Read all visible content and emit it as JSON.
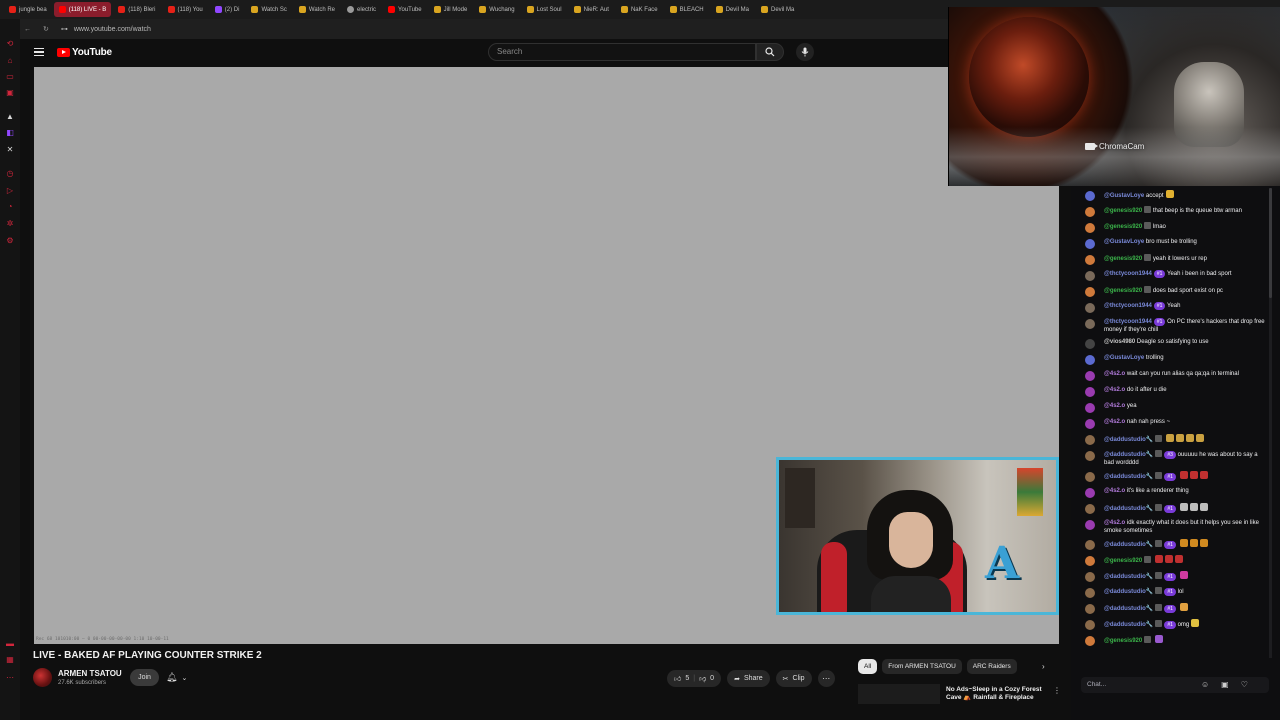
{
  "browser": {
    "tabs": [
      {
        "label": "jungle bea",
        "fav": "red",
        "active": false
      },
      {
        "label": "(118) LIVE - B",
        "fav": "yt",
        "active": true
      },
      {
        "label": "(118) Bleri",
        "fav": "red",
        "active": false
      },
      {
        "label": "(118) You",
        "fav": "red",
        "active": false
      },
      {
        "label": "(2) Di",
        "fav": "purple",
        "active": false
      },
      {
        "label": "Watch Sc",
        "fav": "amber",
        "active": false
      },
      {
        "label": "Watch Re",
        "fav": "amber",
        "active": false
      },
      {
        "label": "electric",
        "fav": "grey",
        "active": false
      },
      {
        "label": "YouTube",
        "fav": "yt",
        "active": false
      },
      {
        "label": "Jill Mode",
        "fav": "amber",
        "active": false
      },
      {
        "label": "Wuchang",
        "fav": "amber",
        "active": false
      },
      {
        "label": "Lost Soul",
        "fav": "amber",
        "active": false
      },
      {
        "label": "NieR: Aut",
        "fav": "amber",
        "active": false
      },
      {
        "label": "NaK Face",
        "fav": "amber",
        "active": false
      },
      {
        "label": "BLEACH",
        "fav": "amber",
        "active": false
      },
      {
        "label": "Devil Ma",
        "fav": "amber",
        "active": false
      },
      {
        "label": "Devil Ma",
        "fav": "amber",
        "active": false
      }
    ],
    "url": "www.youtube.com/watch"
  },
  "youtube": {
    "logo_text": "YouTube",
    "search_placeholder": "Search",
    "video_timecode": "Rec 68 101010:00 — 0 00-00-00-00-00 1:10 10-00-11",
    "video_title": "LIVE - BAKED AF PLAYING COUNTER STRIKE 2",
    "channel_name": "ARMEN TSATOU",
    "subscribers": "27.6K subscribers",
    "join_label": "Join",
    "likes": "5",
    "dislikes": "0",
    "share_label": "Share",
    "clip_label": "Clip",
    "chips": [
      "All",
      "From ARMEN TSATOU",
      "ARC Raiders"
    ],
    "rec_title": "No Ads~Sleep in a Cozy Forest Cave ⛺ Rainfall & Fireplace"
  },
  "overlay": {
    "chroma_label": "ChromaCam"
  },
  "chat": {
    "input_placeholder": "Chat...",
    "messages": [
      {
        "user": "@GustavLoye",
        "color": "u-blue",
        "av": "#5b6ad0",
        "text": "accept",
        "badge": false,
        "sub": "",
        "emotes": [
          "#e0b030"
        ]
      },
      {
        "user": "@genesis920",
        "color": "u-green",
        "av": "#d07a3b",
        "text": "that beep is the queue btw arman",
        "badge": true,
        "sub": "",
        "emotes": []
      },
      {
        "user": "@genesis920",
        "color": "u-green",
        "av": "#d07a3b",
        "text": "lmao",
        "badge": true,
        "sub": "",
        "emotes": []
      },
      {
        "user": "@GustavLoye",
        "color": "u-blue",
        "av": "#5b6ad0",
        "text": "bro must be trolling",
        "badge": false,
        "sub": "",
        "emotes": []
      },
      {
        "user": "@genesis920",
        "color": "u-green",
        "av": "#d07a3b",
        "text": "yeah it lowers ur rep",
        "badge": true,
        "sub": "",
        "emotes": []
      },
      {
        "user": "@thctycoon1944",
        "color": "u-blue",
        "av": "#7a6a5a",
        "text": "Yeah i been in bad sport",
        "badge": false,
        "sub": "#1",
        "emotes": []
      },
      {
        "user": "@genesis920",
        "color": "u-green",
        "av": "#d07a3b",
        "text": "does bad sport exist on pc",
        "badge": true,
        "sub": "",
        "emotes": []
      },
      {
        "user": "@thctycoon1944",
        "color": "u-blue",
        "av": "#7a6a5a",
        "text": "Yeah",
        "badge": false,
        "sub": "#1",
        "emotes": []
      },
      {
        "user": "@thctycoon1944",
        "color": "u-blue",
        "av": "#7a6a5a",
        "text": "On PC there's hackers that drop free money if they're chill",
        "badge": false,
        "sub": "#1",
        "emotes": []
      },
      {
        "user": "@vios4980",
        "color": "u-grey",
        "av": "#444444",
        "text": "Deagle so satisfying to use",
        "badge": false,
        "sub": "",
        "emotes": []
      },
      {
        "user": "@GustavLoye",
        "color": "u-blue",
        "av": "#5b6ad0",
        "text": "trolling",
        "badge": false,
        "sub": "",
        "emotes": []
      },
      {
        "user": "@4s2.o",
        "color": "u-purple",
        "av": "#9a3bb0",
        "text": "wait can you run alias qa qa;qa in terminal",
        "badge": false,
        "sub": "",
        "emotes": []
      },
      {
        "user": "@4s2.o",
        "color": "u-purple",
        "av": "#9a3bb0",
        "text": "do it after u die",
        "badge": false,
        "sub": "",
        "emotes": []
      },
      {
        "user": "@4s2.o",
        "color": "u-purple",
        "av": "#9a3bb0",
        "text": "yea",
        "badge": false,
        "sub": "",
        "emotes": []
      },
      {
        "user": "@4s2.o",
        "color": "u-purple",
        "av": "#9a3bb0",
        "text": "nah nah press ~",
        "badge": false,
        "sub": "",
        "emotes": []
      },
      {
        "user": "@daddustudio🔧",
        "color": "u-blue",
        "av": "#8a6a4a",
        "text": "",
        "badge": true,
        "sub": "",
        "emotes": [
          "#c9a040",
          "#c9a040",
          "#c9a040",
          "#c9a040"
        ]
      },
      {
        "user": "@daddustudio🔧",
        "color": "u-blue",
        "av": "#8a6a4a",
        "text": "ouuuuu he was about to say a bad wordddd",
        "badge": true,
        "sub": "#3",
        "emotes": []
      },
      {
        "user": "@daddustudio🔧",
        "color": "u-blue",
        "av": "#8a6a4a",
        "text": "",
        "badge": true,
        "sub": "#1",
        "emotes": [
          "#c03030",
          "#c03030",
          "#c03030"
        ]
      },
      {
        "user": "@4s2.o",
        "color": "u-purple",
        "av": "#9a3bb0",
        "text": "it's like a renderer thing",
        "badge": false,
        "sub": "",
        "emotes": []
      },
      {
        "user": "@daddustudio🔧",
        "color": "u-blue",
        "av": "#8a6a4a",
        "text": "",
        "badge": true,
        "sub": "#1",
        "emotes": [
          "#bdbdbd",
          "#bdbdbd",
          "#bdbdbd"
        ]
      },
      {
        "user": "@4s2.o",
        "color": "u-purple",
        "av": "#9a3bb0",
        "text": "idk exactly what it does but it helps you see in like smoke sometimes",
        "badge": false,
        "sub": "",
        "emotes": []
      },
      {
        "user": "@daddustudio🔧",
        "color": "u-blue",
        "av": "#8a6a4a",
        "text": "",
        "badge": true,
        "sub": "#1",
        "emotes": [
          "#d08a20",
          "#d08a20",
          "#d08a20"
        ]
      },
      {
        "user": "@genesis920",
        "color": "u-green",
        "av": "#d07a3b",
        "text": "",
        "badge": true,
        "sub": "",
        "emotes": [
          "#c03030",
          "#c03030",
          "#c03030"
        ]
      },
      {
        "user": "@daddustudio🔧",
        "color": "u-blue",
        "av": "#8a6a4a",
        "text": "",
        "badge": true,
        "sub": "#1",
        "emotes": [
          "#d03aa0"
        ]
      },
      {
        "user": "@daddustudio🔧",
        "color": "u-blue",
        "av": "#8a6a4a",
        "text": "lol",
        "badge": true,
        "sub": "#1",
        "emotes": []
      },
      {
        "user": "@daddustudio🔧",
        "color": "u-blue",
        "av": "#8a6a4a",
        "text": "",
        "badge": true,
        "sub": "#1",
        "emotes": [
          "#e0a040"
        ]
      },
      {
        "user": "@daddustudio🔧",
        "color": "u-blue",
        "av": "#8a6a4a",
        "text": "omg",
        "badge": true,
        "sub": "#1",
        "emotes": [
          "#e0c040"
        ]
      },
      {
        "user": "@genesis920",
        "color": "u-green",
        "av": "#d07a3b",
        "text": "",
        "badge": true,
        "sub": "",
        "emotes": [
          "#9a5ad0"
        ]
      }
    ]
  }
}
